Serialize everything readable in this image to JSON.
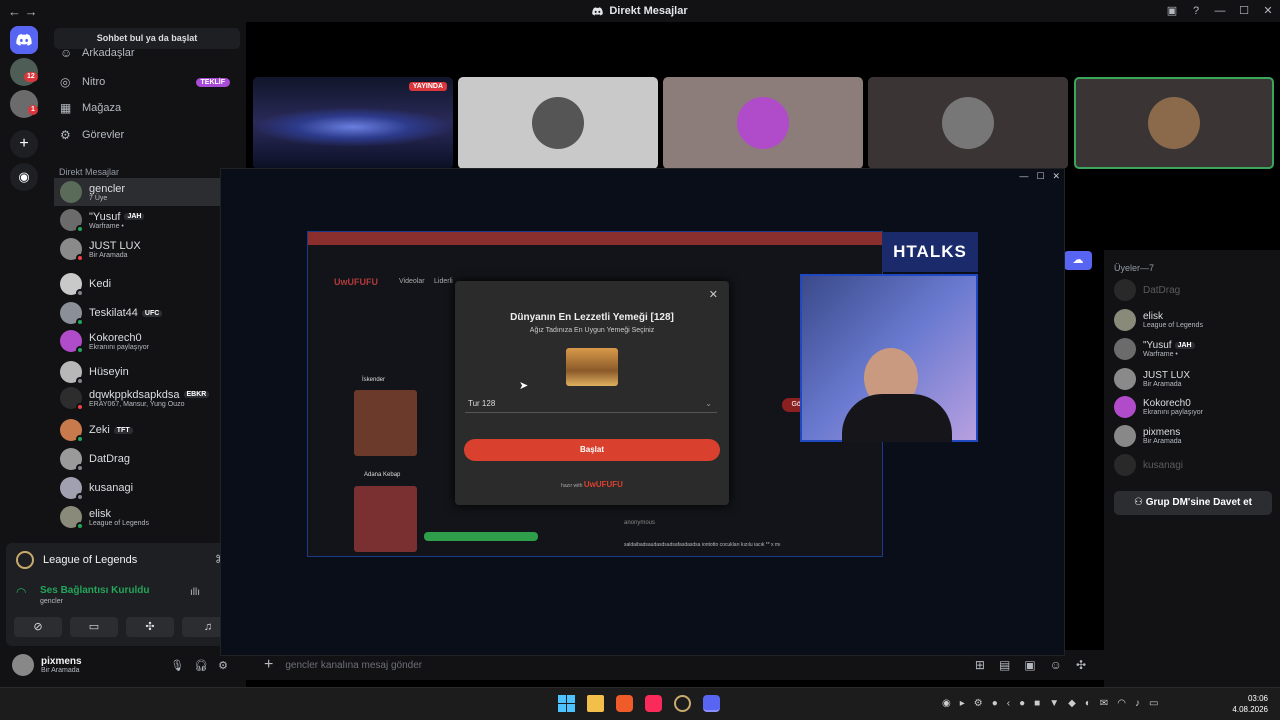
{
  "window": {
    "title": "Direkt Mesajlar"
  },
  "sidebar": {
    "find_label": "Sohbet bul ya da başlat",
    "nav": [
      {
        "label": "Arkadaşlar"
      },
      {
        "label": "Nitro",
        "tag": "TEKLİF"
      },
      {
        "label": "Mağaza"
      },
      {
        "label": "Görevler"
      }
    ],
    "dm_header": "Direkt Mesajlar",
    "dms": [
      {
        "name": "gencler",
        "sub": "7 Üye",
        "color": "#5a6b5a",
        "status": ""
      },
      {
        "name": "\"Yusuf",
        "tag": "JAH",
        "sub": "Warframe •",
        "color": "#6b6b6b",
        "status": "#23a55a"
      },
      {
        "name": "JUST LUX",
        "sub": "Bir Aramada",
        "color": "#8a8a8a",
        "status": "#f23f43"
      },
      {
        "name": "Kedi",
        "sub": "",
        "color": "#c9c9c9",
        "status": "#80848e"
      },
      {
        "name": "Teskilat44",
        "tag": "UFC",
        "sub": "",
        "color": "#8a8f98",
        "status": "#23a55a"
      },
      {
        "name": "Kokorech0",
        "sub": "Ekranını paylaşıyor",
        "color": "#b04cc9",
        "status": "#23a55a"
      },
      {
        "name": "Hüseyin",
        "sub": "",
        "color": "#b8b8b8",
        "status": "#80848e"
      },
      {
        "name": "dqwkppkdsapkdsa",
        "tag": "EBKR",
        "sub": "ERAY067, Mansur, Yung Ouzo",
        "color": "#2d2d2d",
        "status": "#f23f43"
      },
      {
        "name": "Zeki",
        "tag": "TFT",
        "sub": "",
        "color": "#c97a4c",
        "status": "#23a55a"
      },
      {
        "name": "DatDrag",
        "sub": "",
        "color": "#9a9a9a",
        "status": "#80848e"
      },
      {
        "name": "kusanagi",
        "sub": "",
        "color": "#a0a0b0",
        "status": "#80848e"
      },
      {
        "name": "elisk",
        "sub": "League of Legends",
        "color": "#8a8a7a",
        "status": "#23a55a"
      }
    ],
    "game": "League of Legends",
    "voice_status": "Ses Bağlantısı Kuruldu",
    "voice_channel": "gencler",
    "user_name": "pixmens",
    "user_status": "Bir Aramada"
  },
  "rail": {
    "badge1": "12",
    "badge2": "1"
  },
  "call": {
    "live_label": "YAYINDA"
  },
  "popout": {
    "video_title": "Dünyanın En Lezzetli Yemeği [128]",
    "video_subtitle": "Ağız Tadınıza En Uygun Yemeği Seçiniz",
    "select_value": "Tur 128",
    "start_label": "Başlat",
    "brand_prefix": "hazır with",
    "brand": "UwUFUFU",
    "channel_logo": "HTALKS",
    "site_nav": [
      "Videolar",
      "Liderli"
    ],
    "sidebar_labels": [
      "İskender",
      "Adana Kebap"
    ],
    "other_button": "Göster",
    "comment_user": "anonymous",
    "comment_text": "saldaibadsaudasdsadsafasdasdsa iontotto cocukları kızılu iacık ** x mı"
  },
  "members": {
    "header": "Üyeler—7",
    "list": [
      {
        "name": "DatDrag",
        "sub": "",
        "color": "#555",
        "dim": true
      },
      {
        "name": "elisk",
        "sub": "League of Legends",
        "color": "#8a8a7a"
      },
      {
        "name": "\"Yusuf",
        "tag": "JAH",
        "sub": "Warframe •",
        "color": "#6b6b6b"
      },
      {
        "name": "JUST LUX",
        "sub": "Bir Aramada",
        "color": "#8a8a8a"
      },
      {
        "name": "Kokorech0",
        "sub": "Ekranını paylaşıyor",
        "color": "#b04cc9"
      },
      {
        "name": "pixmens",
        "sub": "Bir Aramada",
        "color": "#888"
      },
      {
        "name": "kusanagi",
        "sub": "",
        "color": "#555",
        "dim": true
      }
    ],
    "invite_label": "Grup DM'sine Davet et"
  },
  "chat": {
    "placeholder": "gencler kanalına mesaj gönder"
  },
  "taskbar": {
    "time": "03:06",
    "date": "4.08.2026"
  }
}
